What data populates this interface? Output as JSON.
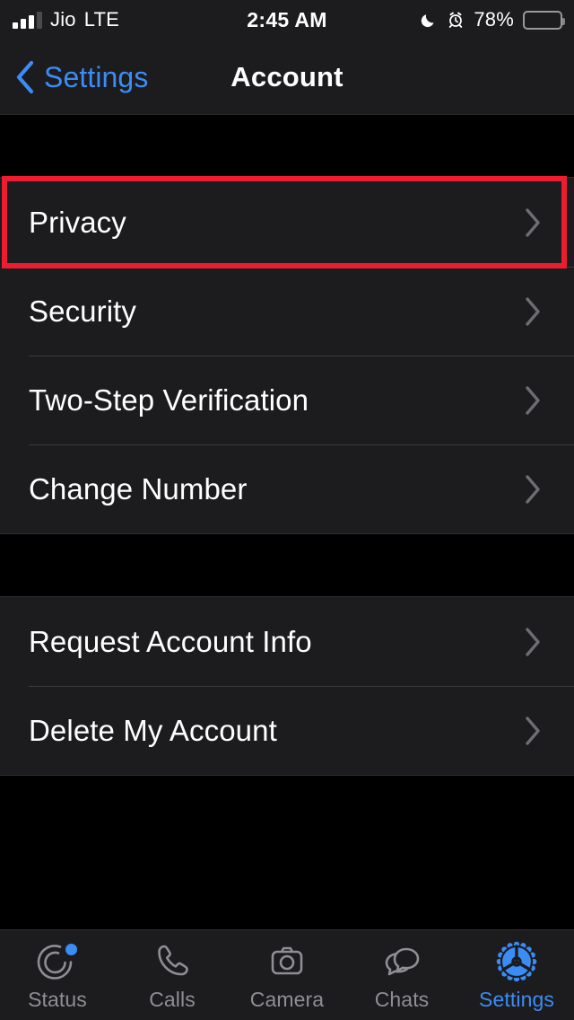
{
  "status_bar": {
    "carrier": "Jio",
    "network": "LTE",
    "time": "2:45 AM",
    "battery_percent": "78%",
    "battery_level": 78,
    "icons": [
      "signal-bars-icon",
      "moon-icon",
      "alarm-icon",
      "battery-icon"
    ]
  },
  "nav_bar": {
    "back_label": "Settings",
    "title": "Account",
    "back_icon": "chevron-left-icon",
    "accent_color": "#3b8cf5"
  },
  "highlight": {
    "target": "Privacy",
    "color": "#ed1c2e"
  },
  "groups": [
    {
      "rows": [
        {
          "label": "Privacy",
          "accessory": "chevron-right-icon"
        },
        {
          "label": "Security",
          "accessory": "chevron-right-icon"
        },
        {
          "label": "Two-Step Verification",
          "accessory": "chevron-right-icon"
        },
        {
          "label": "Change Number",
          "accessory": "chevron-right-icon"
        }
      ]
    },
    {
      "rows": [
        {
          "label": "Request Account Info",
          "accessory": "chevron-right-icon"
        },
        {
          "label": "Delete My Account",
          "accessory": "chevron-right-icon"
        }
      ]
    }
  ],
  "tab_bar": {
    "items": [
      {
        "label": "Status",
        "icon": "status-rings-icon",
        "active": false,
        "badge": true
      },
      {
        "label": "Calls",
        "icon": "phone-icon",
        "active": false,
        "badge": false
      },
      {
        "label": "Camera",
        "icon": "camera-icon",
        "active": false,
        "badge": false
      },
      {
        "label": "Chats",
        "icon": "chat-bubbles-icon",
        "active": false,
        "badge": false
      },
      {
        "label": "Settings",
        "icon": "gear-icon",
        "active": true,
        "badge": false
      }
    ],
    "active_color": "#3b8cf5",
    "inactive_color": "#8e8e93"
  }
}
